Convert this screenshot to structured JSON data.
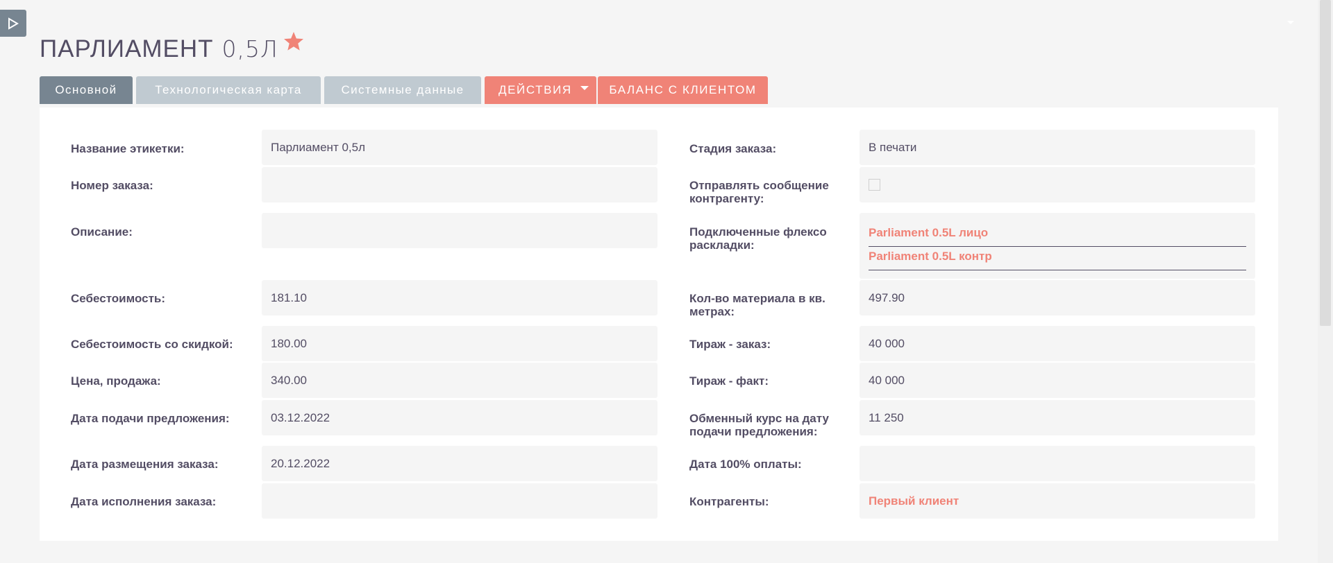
{
  "header": {
    "title_main": "ПАРЛИАМЕНТ",
    "title_sub": "0,5Л"
  },
  "tabs": [
    {
      "label": "Основной"
    },
    {
      "label": "Технологическая карта"
    },
    {
      "label": "Системные данные"
    },
    {
      "label": "ДЕЙСТВИЯ"
    },
    {
      "label": "БАЛАНС С КЛИЕНТОМ"
    }
  ],
  "left_fields": {
    "label_name": "Название этикетки:",
    "value_name": "Парлиамент 0,5л",
    "label_order_no": "Номер заказа:",
    "value_order_no": "",
    "label_description": "Описание:",
    "value_description": "",
    "label_cost": "Себестоимость:",
    "value_cost": "181.10",
    "label_cost_discount": "Себестоимость со скидкой:",
    "value_cost_discount": "180.00",
    "label_price": "Цена, продажа:",
    "value_price": "340.00",
    "label_offer_date": "Дата подачи предложения:",
    "value_offer_date": "03.12.2022",
    "label_placement_date": "Дата размещения заказа:",
    "value_placement_date": "20.12.2022",
    "label_completion_date": "Дата исполнения заказа:",
    "value_completion_date": ""
  },
  "right_fields": {
    "label_stage": "Стадия заказа:",
    "value_stage": "В печати",
    "label_notify_line1": "Отправлять сообщение",
    "label_notify_line2": "контрагенту:",
    "notify_checked": false,
    "label_flexo_line1": "Подключенные флексо",
    "label_flexo_line2": "раскладки:",
    "flexo_items": [
      "Parliament 0.5L лицо",
      "Parliament 0.5L контр"
    ],
    "label_material_line1": "Кол-во материала в кв.",
    "label_material_line2": "метрах:",
    "value_material": "497.90",
    "label_run_order": "Тираж - заказ:",
    "value_run_order": "40 000",
    "label_run_fact": "Тираж - факт:",
    "value_run_fact": "40 000",
    "label_rate_line1": "Обменный курс на дату",
    "label_rate_line2": "подачи предложения:",
    "value_rate": "11 250",
    "label_payment_date": "Дата 100% оплаты:",
    "value_payment_date": "",
    "label_contractors": "Контрагенты:",
    "value_contractors": "Первый клиент"
  },
  "colors": {
    "accent": "#f08377",
    "tab_active": "#778591",
    "tab_inactive": "#c0cad1",
    "text": "#534d64",
    "field_bg": "#f5f5f5"
  },
  "icons": {
    "sidebar_toggle": "play-triangle-icon",
    "favorite": "star-icon",
    "dropdown": "caret-down-icon"
  }
}
